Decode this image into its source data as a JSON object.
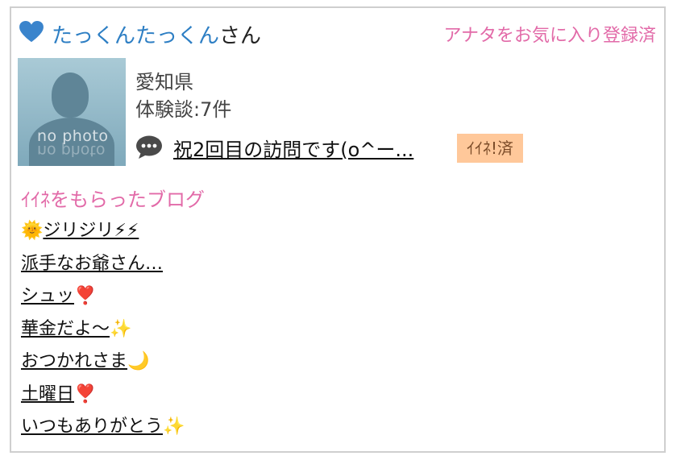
{
  "header": {
    "username": "たっくんたっくん",
    "honorific": "さん",
    "favorite_status": "アナタをお気に入り登録済",
    "heart_color": "#3a84cc"
  },
  "profile": {
    "avatar_text": "no photo",
    "prefecture": "愛知県",
    "reviews_label": "体験談",
    "reviews_sep": ":",
    "reviews_count": "7件",
    "latest_post": "祝2回目の訪問です(o^ー...",
    "like_badge": "ｲｲﾈ!済",
    "comment_icon": "speech-bubble-icon"
  },
  "liked_blogs": {
    "title": "ｲｲﾈをもらったブログ",
    "items": [
      {
        "emoji_prefix": "🌞",
        "text": "ジリジリ⚡⚡",
        "emoji_suffix": ""
      },
      {
        "emoji_prefix": "",
        "text": "派手なお爺さん…",
        "emoji_suffix": ""
      },
      {
        "emoji_prefix": "",
        "text": "シュッ",
        "emoji_suffix": "❣️"
      },
      {
        "emoji_prefix": "",
        "text": "華金だよ〜",
        "emoji_suffix": "✨"
      },
      {
        "emoji_prefix": "",
        "text": "おつかれさま",
        "emoji_suffix": "🌙"
      },
      {
        "emoji_prefix": "",
        "text": "土曜日",
        "emoji_suffix": "❣️"
      },
      {
        "emoji_prefix": "",
        "text": "いつもありがとう",
        "emoji_suffix": "✨"
      }
    ]
  },
  "colors": {
    "accent_pink": "#e26aa8",
    "username_blue": "#2e7fc4",
    "badge_bg": "#ffc89a"
  }
}
